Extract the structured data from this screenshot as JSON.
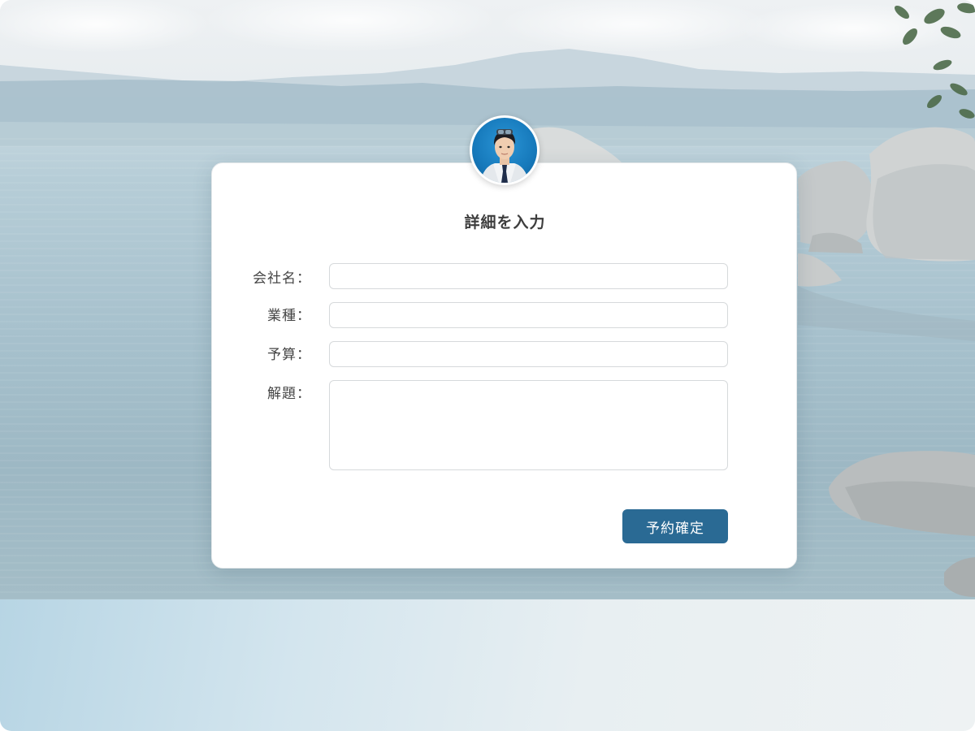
{
  "form": {
    "title": "詳細を入力",
    "fields": [
      {
        "label": "会社名：",
        "value": "",
        "placeholder": ""
      },
      {
        "label": "業種：",
        "value": "",
        "placeholder": ""
      },
      {
        "label": "予算：",
        "value": "",
        "placeholder": ""
      },
      {
        "label": "解題：",
        "value": "",
        "placeholder": ""
      }
    ],
    "submit_label": "予約確定"
  },
  "avatar": {
    "icon": "person-avatar-icon"
  },
  "colors": {
    "accent": "#2a6a94",
    "title_text": "#3d3d3d",
    "label_text": "#444444",
    "input_border": "#d6d9db",
    "avatar_background": "#1679bb"
  }
}
